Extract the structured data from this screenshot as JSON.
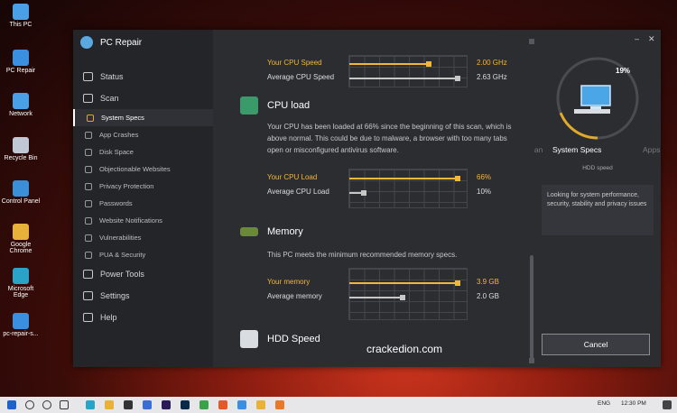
{
  "desktop": {
    "icons": [
      {
        "label": "This PC",
        "icon": "computer-icon",
        "color": "#4aa0e6"
      },
      {
        "label": "PC Repair",
        "icon": "pc-repair-icon",
        "color": "#3a8fe0"
      },
      {
        "label": "Network",
        "icon": "network-icon",
        "color": "#4aa0e6"
      },
      {
        "label": "Recycle Bin",
        "icon": "recycle-bin-icon",
        "color": "#bfc8d4"
      },
      {
        "label": "Control Panel",
        "icon": "control-panel-icon",
        "color": "#3b8ed8"
      },
      {
        "label": "Google Chrome",
        "icon": "chrome-icon",
        "color": "#e8b23a"
      },
      {
        "label": "Microsoft Edge",
        "icon": "edge-icon",
        "color": "#2aa3c9"
      },
      {
        "label": "pc-repair-s...",
        "icon": "pc-repair-setup-icon",
        "color": "#3a8fe0"
      }
    ]
  },
  "app": {
    "title": "PC Repair",
    "nav": [
      {
        "label": "Status",
        "icon": "monitor-icon",
        "level": "top"
      },
      {
        "label": "Scan",
        "icon": "search-icon",
        "level": "top"
      },
      {
        "label": "System Specs",
        "icon": "gauge-icon",
        "level": "sub",
        "active": true
      },
      {
        "label": "App Crashes",
        "icon": "crash-icon",
        "level": "sub"
      },
      {
        "label": "Disk Space",
        "icon": "disk-icon",
        "level": "sub"
      },
      {
        "label": "Objectionable Websites",
        "icon": "globe-icon",
        "level": "sub"
      },
      {
        "label": "Privacy Protection",
        "icon": "lock-icon",
        "level": "sub"
      },
      {
        "label": "Passwords",
        "icon": "key-icon",
        "level": "sub"
      },
      {
        "label": "Website Notifications",
        "icon": "bell-icon",
        "level": "sub"
      },
      {
        "label": "Vulnerabilities",
        "icon": "bug-icon",
        "level": "sub"
      },
      {
        "label": "PUA & Security",
        "icon": "shield-icon",
        "level": "sub"
      },
      {
        "label": "Power Tools",
        "icon": "wrench-icon",
        "level": "top"
      },
      {
        "label": "Settings",
        "icon": "gear-icon",
        "level": "top"
      },
      {
        "label": "Help",
        "icon": "help-icon",
        "level": "top"
      }
    ]
  },
  "main": {
    "cpu_speed": {
      "your_label": "Your CPU Speed",
      "your_value": "2.00 GHz",
      "your_fraction": 0.68,
      "avg_label": "Average CPU Speed",
      "avg_value": "2.63 GHz",
      "avg_fraction": 0.92
    },
    "cpu_load": {
      "title": "CPU load",
      "text": "Your CPU has been loaded at 66% since the beginning of this scan, which is above normal. This could be due to malware, a browser with too many tabs open or misconfigured antivirus software.",
      "your_label": "Your CPU Load",
      "your_value": "66%",
      "your_fraction": 0.92,
      "avg_label": "Average CPU Load",
      "avg_value": "10%",
      "avg_fraction": 0.12
    },
    "memory": {
      "title": "Memory",
      "text": "This PC meets the minimum recommended memory specs.",
      "your_label": "Your memory",
      "your_value": "3.9 GB",
      "your_fraction": 0.92,
      "avg_label": "Average memory",
      "avg_value": "2.0 GB",
      "avg_fraction": 0.45
    },
    "hdd": {
      "title": "HDD Speed"
    }
  },
  "right": {
    "progress": "19%",
    "progress_fraction": 0.19,
    "tab_prev": "Scan",
    "tab_current": "System Specs",
    "tab_next": "Apps",
    "subtitle": "HDD speed",
    "info": "Looking for system performance, security, stability and privacy issues",
    "cancel": "Cancel",
    "minimize": "–",
    "close": "✕"
  },
  "watermark": "crackedion.com",
  "taskbar": {
    "language": "ENG",
    "time": "12:30 PM",
    "apps": [
      {
        "icon": "edge-taskbar-icon",
        "color": "#2aa3c9"
      },
      {
        "icon": "file-explorer-icon",
        "color": "#e8b23a"
      },
      {
        "icon": "store-icon",
        "color": "#333"
      },
      {
        "icon": "mail-icon",
        "color": "#3a6fd0"
      },
      {
        "icon": "premiere-icon",
        "color": "#2a1a5a"
      },
      {
        "icon": "photoshop-icon",
        "color": "#0a2a4a"
      },
      {
        "icon": "camtasia-icon",
        "color": "#3aa34a"
      },
      {
        "icon": "ccleaner-icon",
        "color": "#e05a2a"
      },
      {
        "icon": "pc-repair-taskbar-icon",
        "color": "#3a8fe0"
      },
      {
        "icon": "chrome-taskbar-icon",
        "color": "#e8b23a"
      },
      {
        "icon": "vlc-icon",
        "color": "#e8782a"
      }
    ]
  },
  "colors": {
    "accent": "#f2b638",
    "window_bg": "#2b2d31",
    "sidebar_bg": "#242529"
  }
}
